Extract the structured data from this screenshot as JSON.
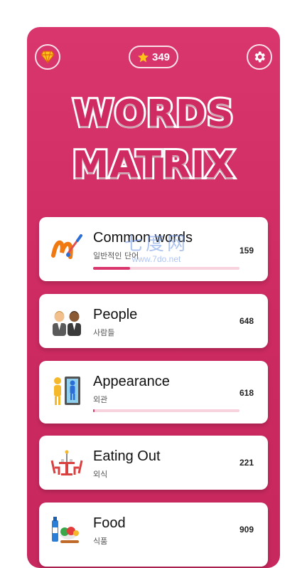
{
  "header": {
    "gem_icon": "diamond-icon",
    "stars_icon": "star-icon",
    "stars_count": "349",
    "settings_icon": "gear-icon"
  },
  "logo": {
    "line1": "WORDS",
    "line2": "MATRIX"
  },
  "categories": [
    {
      "title": "Common words",
      "subtitle": "일반적인 단어",
      "count": "159",
      "progress": 0.25,
      "icon": "paintbrush-icon"
    },
    {
      "title": "People",
      "subtitle": "사람들",
      "count": "648",
      "icon": "people-icon"
    },
    {
      "title": "Appearance",
      "subtitle": "외관",
      "count": "618",
      "progress": 0.01,
      "icon": "mirror-icon"
    },
    {
      "title": "Eating Out",
      "subtitle": "외식",
      "count": "221",
      "icon": "dining-table-icon"
    },
    {
      "title": "Food",
      "subtitle": "식품",
      "count": "909",
      "icon": "groceries-icon"
    }
  ],
  "watermark": {
    "line1": "七度网",
    "line2": "www.7do.net"
  },
  "colors": {
    "accent": "#d8366c",
    "background": "#cc2a60",
    "card": "#ffffff"
  }
}
